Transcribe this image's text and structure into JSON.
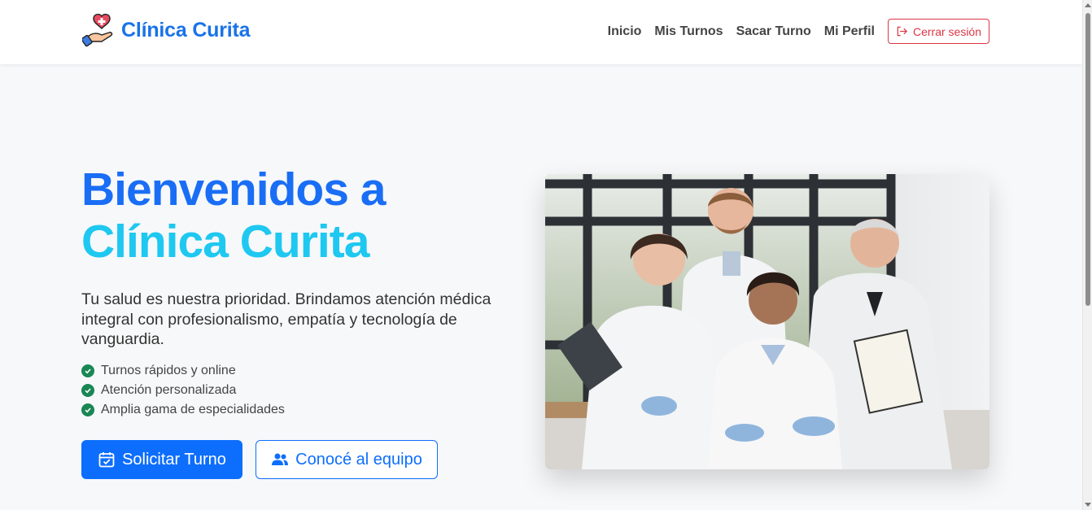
{
  "brand": {
    "name": "Clínica Curita",
    "logo_icon": "heart-hand-icon"
  },
  "nav": {
    "items": [
      {
        "label": "Inicio"
      },
      {
        "label": "Mis Turnos"
      },
      {
        "label": "Sacar Turno"
      },
      {
        "label": "Mi Perfil"
      }
    ],
    "logout_label": "Cerrar sesión"
  },
  "hero": {
    "title_part1": "Bienvenidos a ",
    "title_part2": "Clínica Curita",
    "lead": "Tu salud es nuestra prioridad. Brindamos atención médica integral con profesionalismo, empatía y tecnología de vanguardia.",
    "features": [
      "Turnos rápidos y online",
      "Atención personalizada",
      "Amplia gama de especialidades"
    ],
    "primary_button": "Solicitar Turno",
    "secondary_button": "Conocé al equipo",
    "image_description_icon": "medical-team-photo"
  },
  "colors": {
    "primary": "#0d6efd",
    "title_blue": "#1a6ef5",
    "title_cyan": "#1ec8f0",
    "danger": "#dc3545",
    "success": "#198754"
  }
}
